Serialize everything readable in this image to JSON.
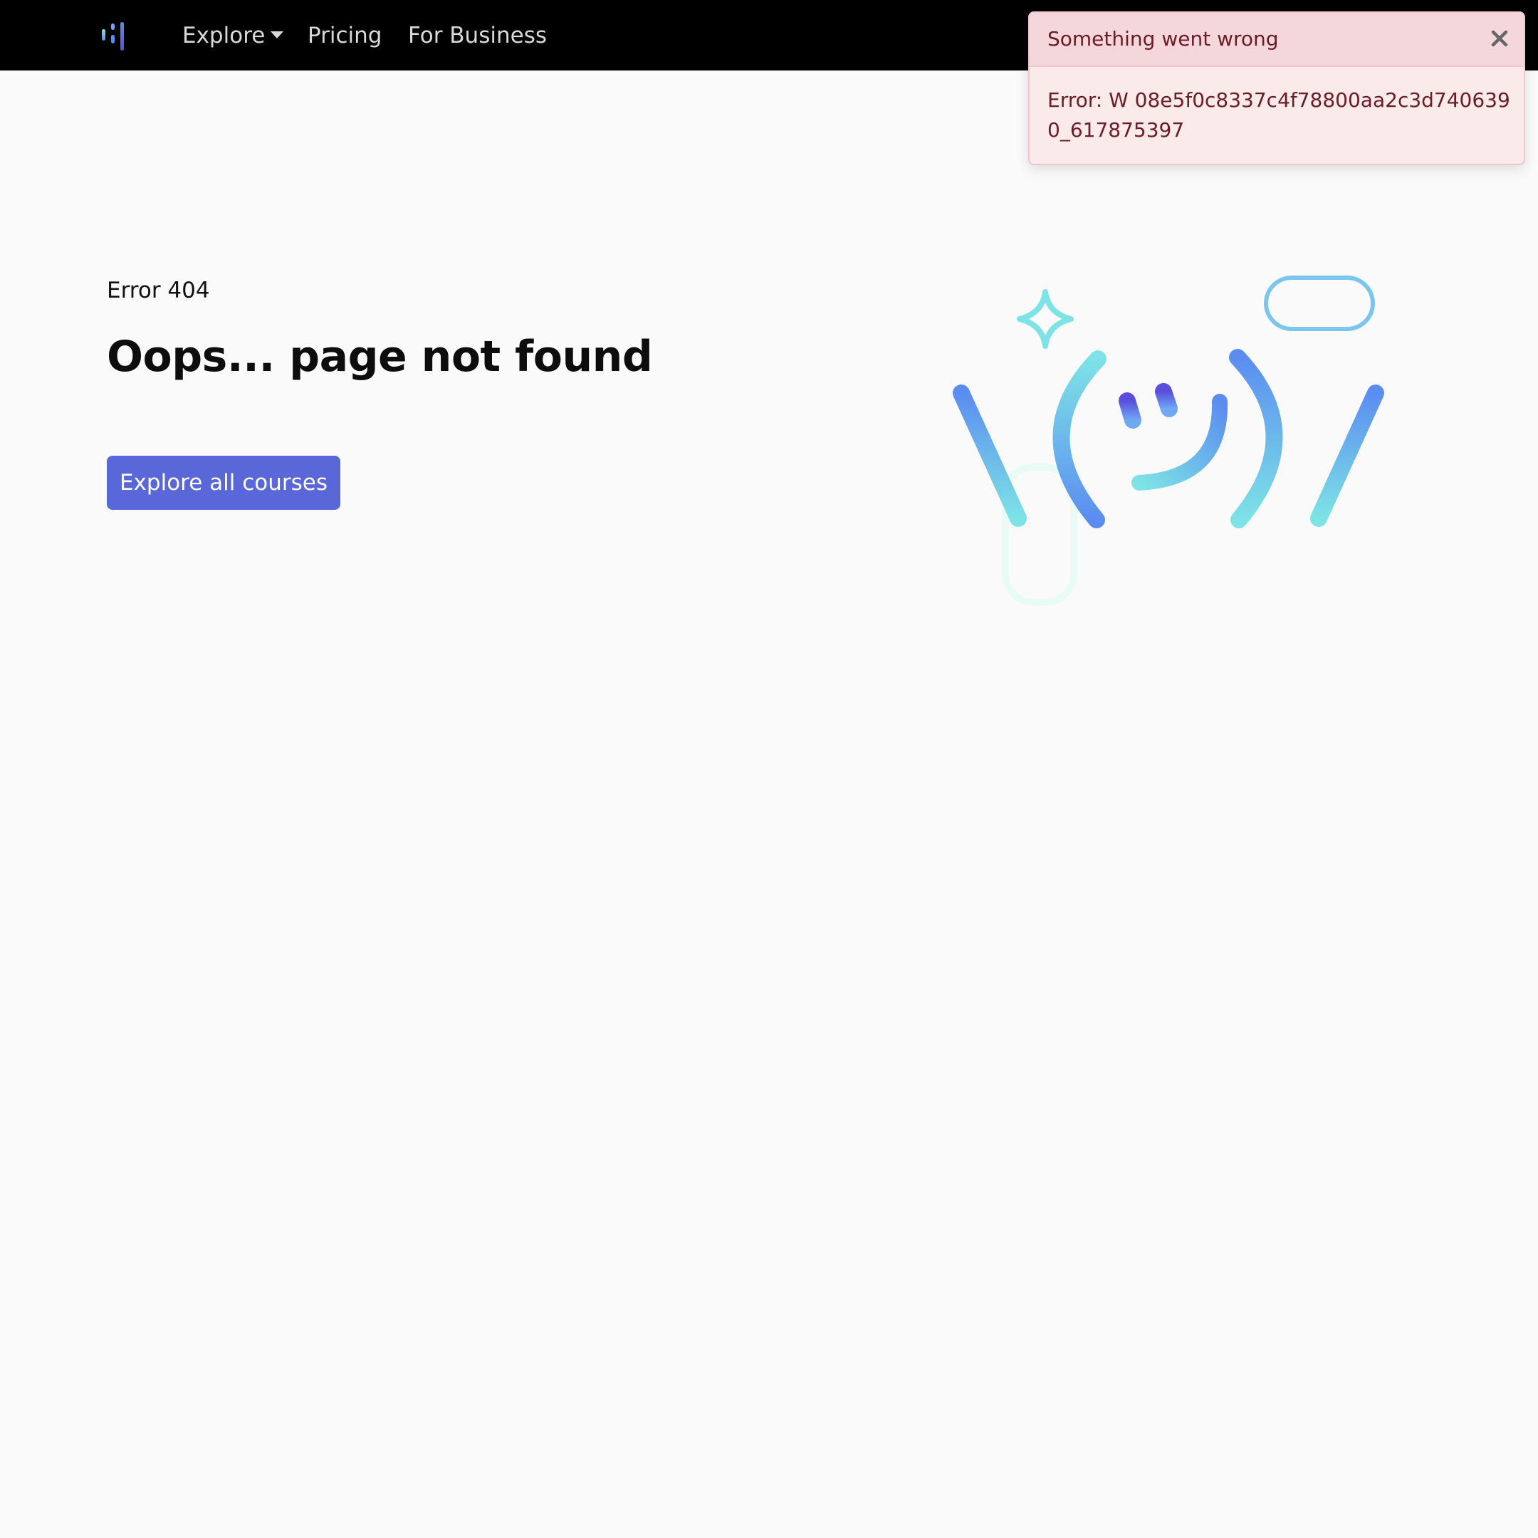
{
  "nav": {
    "logo_icon": "bars-logo-icon",
    "items": [
      {
        "label": "Explore",
        "has_dropdown": true
      },
      {
        "label": "Pricing"
      },
      {
        "label": "For Business"
      }
    ]
  },
  "main": {
    "error_label": "Error 404",
    "title": "Oops... page not found",
    "cta_label": "Explore all courses",
    "illustration_icon": "shrug-emoticon-illustration"
  },
  "toast": {
    "title": "Something went wrong",
    "body": "Error: W 08e5f0c8337c4f78800aa2c3d7406390_617875397",
    "close_icon": "close-icon"
  },
  "colors": {
    "navbar_bg": "#000000",
    "page_bg": "#fafafa",
    "accent": "#5a67d8",
    "toast_bg": "#fbeaea",
    "toast_header_bg": "#f4d7db",
    "toast_text": "#6b1c24",
    "gradient_blue": "#5b8df0",
    "gradient_cyan": "#7de3e6",
    "gradient_indigo": "#5a4fdc"
  }
}
